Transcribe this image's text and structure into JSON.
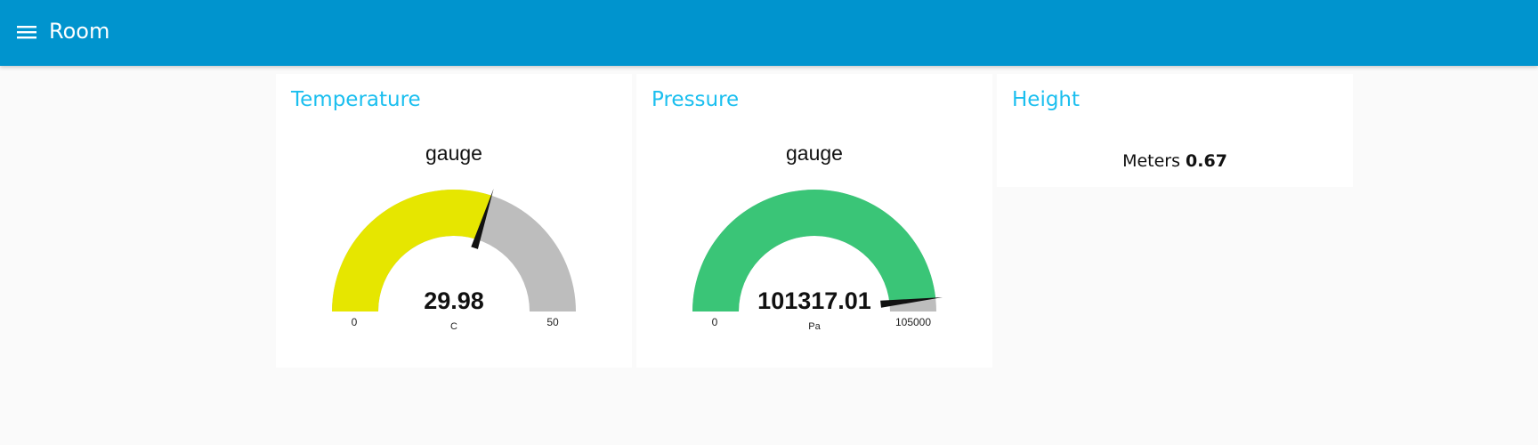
{
  "header": {
    "title": "Room",
    "menu_icon": "hamburger-menu-icon",
    "background": "#0094ce"
  },
  "cards": {
    "temperature": {
      "title": "Temperature",
      "gauge": {
        "label": "gauge",
        "value": 29.98,
        "value_text": "29.98",
        "min": 0,
        "max": 50,
        "min_text": "0",
        "max_text": "50",
        "units": "C",
        "fill_color": "#e6e600",
        "track_color": "#bdbdbd"
      }
    },
    "pressure": {
      "title": "Pressure",
      "gauge": {
        "label": "gauge",
        "value": 101317.01,
        "value_text": "101317.01",
        "min": 0,
        "max": 105000,
        "min_text": "0",
        "max_text": "105000",
        "units": "Pa",
        "fill_color": "#3ac577",
        "track_color": "#bdbdbd"
      }
    },
    "height": {
      "title": "Height",
      "label": "Meters",
      "value": "0.67"
    }
  },
  "colors": {
    "title_accent": "#1bbfef",
    "page_background": "#fafafa",
    "card_background": "#ffffff"
  }
}
